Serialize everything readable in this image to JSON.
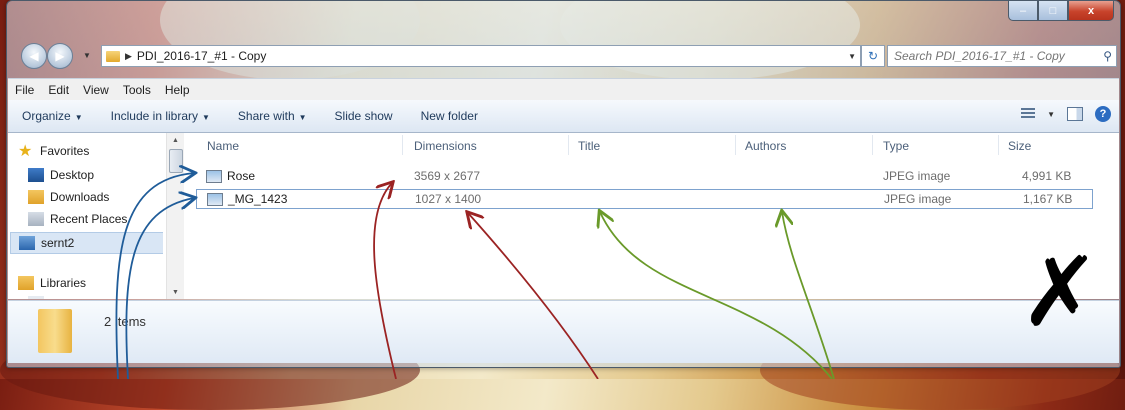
{
  "window": {
    "caption_buttons": {
      "minimize": "–",
      "maximize": "□",
      "close": "x"
    }
  },
  "address_bar": {
    "path": "PDI_2016-17_#1 - Copy",
    "search_placeholder": "Search PDI_2016-17_#1 - Copy"
  },
  "menu": [
    "File",
    "Edit",
    "View",
    "Tools",
    "Help"
  ],
  "toolbar": {
    "organize": "Organize",
    "include_in_library": "Include in library",
    "share_with": "Share with",
    "slide_show": "Slide show",
    "new_folder": "New folder"
  },
  "nav_pane": {
    "favorites": "Favorites",
    "items": [
      "Desktop",
      "Downloads",
      "Recent Places",
      "sernt2"
    ],
    "libraries": "Libraries"
  },
  "columns": [
    "Name",
    "Dimensions",
    "Title",
    "Authors",
    "Type",
    "Size"
  ],
  "files": [
    {
      "name": "Rose",
      "dimensions": "3569 x 2677",
      "title": "",
      "authors": "",
      "type": "JPEG image",
      "size": "4,991 KB"
    },
    {
      "name": "_MG_1423",
      "dimensions": "1027 x 1400",
      "title": "",
      "authors": "",
      "type": "JPEG image",
      "size": "1,167 KB"
    }
  ],
  "status": {
    "count": "2 items"
  },
  "annotation": {
    "mark": "✗",
    "colors": {
      "blue": "#1f5c99",
      "red": "#9b2323",
      "green": "#6a9a2a"
    }
  }
}
